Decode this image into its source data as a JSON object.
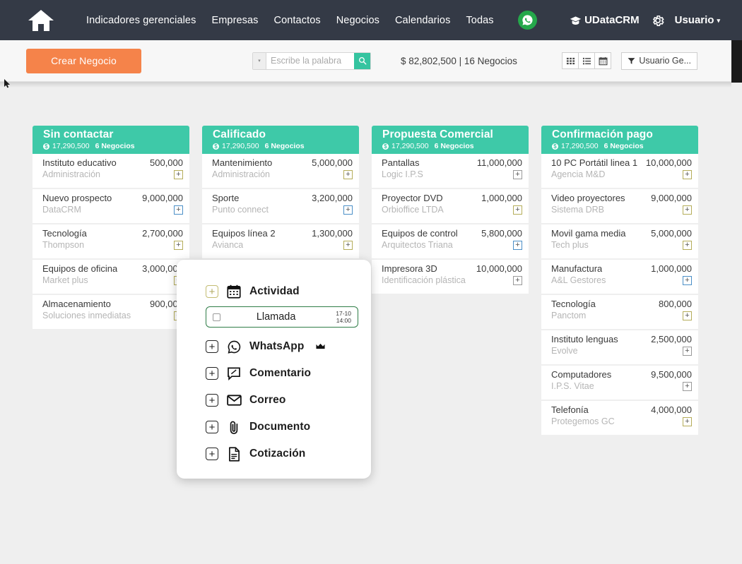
{
  "nav": {
    "home_icon": "home-icon",
    "links": [
      {
        "label": "Indicadores gerenciales"
      },
      {
        "label": "Empresas"
      },
      {
        "label": "Contactos"
      },
      {
        "label": "Negocios"
      },
      {
        "label": "Calendarios"
      },
      {
        "label": "Todas"
      }
    ],
    "whatsapp_icon": "whatsapp-icon",
    "brand": "UDataCRM",
    "brand_icon": "graduation-cap-icon",
    "gear_icon": "gear-icon",
    "user": "Usuario",
    "user_caret": "▾"
  },
  "toolbar": {
    "create_label": "Crear Negocio",
    "search_caret": "▾",
    "search_value": "",
    "search_placeholder": "Escribe la palabra",
    "search_icon": "search-icon",
    "summary": "$ 82,802,500 | 16 Negocios",
    "views": [
      {
        "name": "grid-view",
        "icon": "grid-icon"
      },
      {
        "name": "list-view",
        "icon": "list-icon"
      },
      {
        "name": "calendar-view",
        "icon": "calendar-icon"
      }
    ],
    "filter_icon": "funnel-icon",
    "filter_label": "Usuario Ge..."
  },
  "colors": {
    "nav_bg": "#343a46",
    "accent_orange": "#f5834a",
    "accent_teal": "#3ec9a8",
    "search_green": "#35c4a0",
    "board_bg": "#efefef",
    "badge_olive": "#b5ad5a",
    "badge_blue": "#4b8fc7",
    "llamada_border": "#2f7d47"
  },
  "board": {
    "columns": [
      {
        "title": "Sin contactar",
        "amount": "17,290,500",
        "count": "6 Negocios",
        "cards": [
          {
            "name": "Instituto educativo",
            "amount": "500,000",
            "company": "Administración",
            "badge": "olive"
          },
          {
            "name": "Nuevo prospecto",
            "amount": "9,000,000",
            "company": "DataCRM",
            "badge": "blue"
          },
          {
            "name": "Tecnología",
            "amount": "2,700,000",
            "company": "Thompson",
            "badge": "olive"
          },
          {
            "name": "Equipos de oficina",
            "amount": "3,000,000",
            "company": "Market plus",
            "badge": "olive"
          },
          {
            "name": "Almacenamiento",
            "amount": "900,000",
            "company": "Soluciones inmediatas",
            "badge": "olive"
          }
        ]
      },
      {
        "title": "Calificado",
        "amount": "17,290,500",
        "count": "6 Negocios",
        "cards": [
          {
            "name": "Mantenimiento",
            "amount": "5,000,000",
            "company": "Administración",
            "badge": "olive"
          },
          {
            "name": "Sporte",
            "amount": "3,200,000",
            "company": "Punto connect",
            "badge": "blue"
          },
          {
            "name": "Equipos línea 2",
            "amount": "1,300,000",
            "company": "Avianca",
            "badge": "olive"
          }
        ]
      },
      {
        "title": "Propuesta Comercial",
        "amount": "17,290,500",
        "count": "6 Negocios",
        "cards": [
          {
            "name": "Pantallas",
            "amount": "11,000,000",
            "company": "Logic I.P.S",
            "badge": "gray"
          },
          {
            "name": "Proyector DVD",
            "amount": "1,000,000",
            "company": "Orbioffice LTDA",
            "badge": "olive"
          },
          {
            "name": "Equipos de control",
            "amount": "5,800,000",
            "company": "Arquitectos Triana",
            "badge": "blue"
          },
          {
            "name": "Impresora 3D",
            "amount": "10,000,000",
            "company": "Identificación plástica",
            "badge": "gray"
          }
        ]
      },
      {
        "title": "Confirmación pago",
        "amount": "17,290,500",
        "count": "6 Negocios",
        "cards": [
          {
            "name": "10 PC Portátil linea 1",
            "amount": "10,000,000",
            "company": "Agencia M&D",
            "badge": "olive"
          },
          {
            "name": "Video proyectores",
            "amount": "9,000,000",
            "company": "Sistema DRB",
            "badge": "olive"
          },
          {
            "name": "Movil gama media",
            "amount": "5,000,000",
            "company": "Tech plus",
            "badge": "olive"
          },
          {
            "name": "Manufactura",
            "amount": "1,000,000",
            "company": "A&L Gestores",
            "badge": "blue"
          },
          {
            "name": "Tecnología",
            "amount": "800,000",
            "company": "Panctom",
            "badge": "olive"
          },
          {
            "name": "Instituto lenguas",
            "amount": "2,500,000",
            "company": "Evolve",
            "badge": "gray"
          },
          {
            "name": "Computadores",
            "amount": "9,500,000",
            "company": "I.P.S. Vitae",
            "badge": "gray"
          },
          {
            "name": "Telefonía",
            "amount": "4,000,000",
            "company": "Protegemos GC",
            "badge": "olive"
          }
        ]
      }
    ]
  },
  "popup": {
    "items": [
      {
        "label": "Actividad",
        "icon": "calendar-icon",
        "plus": "olive"
      },
      {
        "label": "WhatsApp",
        "icon": "whatsapp-icon",
        "plus": "dark",
        "premium": true
      },
      {
        "label": "Comentario",
        "icon": "comment-icon",
        "plus": "dark"
      },
      {
        "label": "Correo",
        "icon": "envelope-icon",
        "plus": "dark"
      },
      {
        "label": "Documento",
        "icon": "paperclip-icon",
        "plus": "dark"
      },
      {
        "label": "Cotización",
        "icon": "document-icon",
        "plus": "dark"
      }
    ],
    "llamada": {
      "label": "Llamada",
      "date": "17-10",
      "time": "14:00",
      "checked": false
    }
  }
}
